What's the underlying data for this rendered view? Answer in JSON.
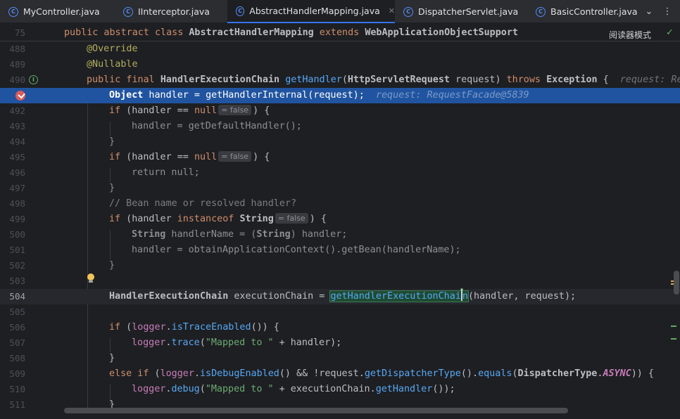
{
  "tabs": [
    {
      "name": "MyController.java",
      "icon": "class-icon",
      "active": false
    },
    {
      "name": "IInterceptor.java",
      "icon": "class-icon",
      "active": false
    },
    {
      "name": "AbstractHandlerMapping.java",
      "icon": "class-icon",
      "active": true
    },
    {
      "name": "DispatcherServlet.java",
      "icon": "class-icon",
      "active": false
    },
    {
      "name": "BasicController.java",
      "icon": "class-icon",
      "active": false
    }
  ],
  "tab_icon_letter": "C",
  "tab_close": "✕",
  "tab_overflow": "⌄",
  "tab_menu": "⋮",
  "reader_mode": "阅读器模式",
  "status_check": "✓",
  "lines": {
    "l75": "75",
    "l488": "488",
    "l489": "489",
    "l490": "490",
    "l492": "492",
    "l493": "493",
    "l494": "494",
    "l495": "495",
    "l496": "496",
    "l497": "497",
    "l498": "498",
    "l499": "499",
    "l500": "500",
    "l501": "501",
    "l502": "502",
    "l503": "503",
    "l504": "504",
    "l505": "505",
    "l506": "506",
    "l507": "507",
    "l508": "508",
    "l509": "509",
    "l510": "510",
    "l511": "511"
  },
  "code": {
    "sticky": {
      "kw1": "public abstract class ",
      "cls": "AbstractHandlerMapping",
      "kw2": " extends ",
      "parent": "WebApplicationObjectSupport"
    },
    "l488": "@Override",
    "l489": "@Nullable",
    "l490": {
      "kw": "public final ",
      "ty": "HandlerExecutionChain",
      "fn": "getHandler",
      "p1": "(",
      "pty": "HttpServletRequest",
      "p2": " request) ",
      "kw2": "throws ",
      "ex": "Exception",
      "p3": " {",
      "hint": "request: Re"
    },
    "l491": {
      "ty": "Object",
      "t1": " handler = ",
      "fn": "getHandlerInternal",
      "t2": "(request);",
      "hint": "request: RequestFacade@5839"
    },
    "l492": {
      "kw": "if",
      "t1": " (handler == ",
      "kw2": "null",
      "badge": "= false",
      "t2": ") {"
    },
    "l493": "handler = getDefaultHandler();",
    "l494": "}",
    "l495": {
      "kw": "if",
      "t1": " (handler == ",
      "kw2": "null",
      "badge": "= false",
      "t2": ") {"
    },
    "l496": "return null;",
    "l497": "}",
    "l498": "// Bean name or resolved handler?",
    "l499": {
      "kw": "if",
      "t1": " (handler ",
      "kw2": "instanceof ",
      "ty": "String",
      "badge": "= false",
      "t2": ") {"
    },
    "l500": {
      "ty": "String",
      "t1": " handlerName = (",
      "ty2": "String",
      "t2": ") handler;"
    },
    "l501": "handler = obtainApplicationContext().getBean(handlerName);",
    "l502": "}",
    "l504": {
      "ty": "HandlerExecutionChain",
      "t1": " executionChain = ",
      "fn": "getHandlerExecutionChai",
      "fn2": "n",
      "t2": "(handler, request);"
    },
    "l506": {
      "kw": "if",
      "t1": " (",
      "fi": "logger",
      "t2": ".",
      "fn": "isTraceEnabled",
      "t3": "()) {"
    },
    "l507": {
      "fi": "logger",
      "t1": ".",
      "fn": "trace",
      "t2": "(",
      "str": "\"Mapped to \"",
      "t3": " + handler);"
    },
    "l508": "}",
    "l509": {
      "kw": "else if",
      "t1": " (",
      "fi": "logger",
      "t2": ".",
      "fn": "isDebugEnabled",
      "t3": "() && !request.",
      "fn2": "getDispatcherType",
      "t4": "().",
      "fn3": "equals",
      "t5": "(",
      "ty": "DispatcherType",
      "t6": ".",
      "en": "ASYNC",
      "t7": ")) {"
    },
    "l510": {
      "fi": "logger",
      "t1": ".",
      "fn": "debug",
      "t2": "(",
      "str": "\"Mapped to \"",
      "t3": " + executionChain.",
      "fn2": "getHandler",
      "t4": "());"
    },
    "l511": "}"
  },
  "gutter_icons": {
    "override": "I",
    "override_icon": "overrides-method-icon",
    "breakpoint_icon": "breakpoint-icon",
    "intention_icon": "lightbulb-icon"
  },
  "colors": {
    "accent": "#3574f0",
    "exec_line": "#2154a0",
    "breakpoint": "#db5c5c"
  }
}
